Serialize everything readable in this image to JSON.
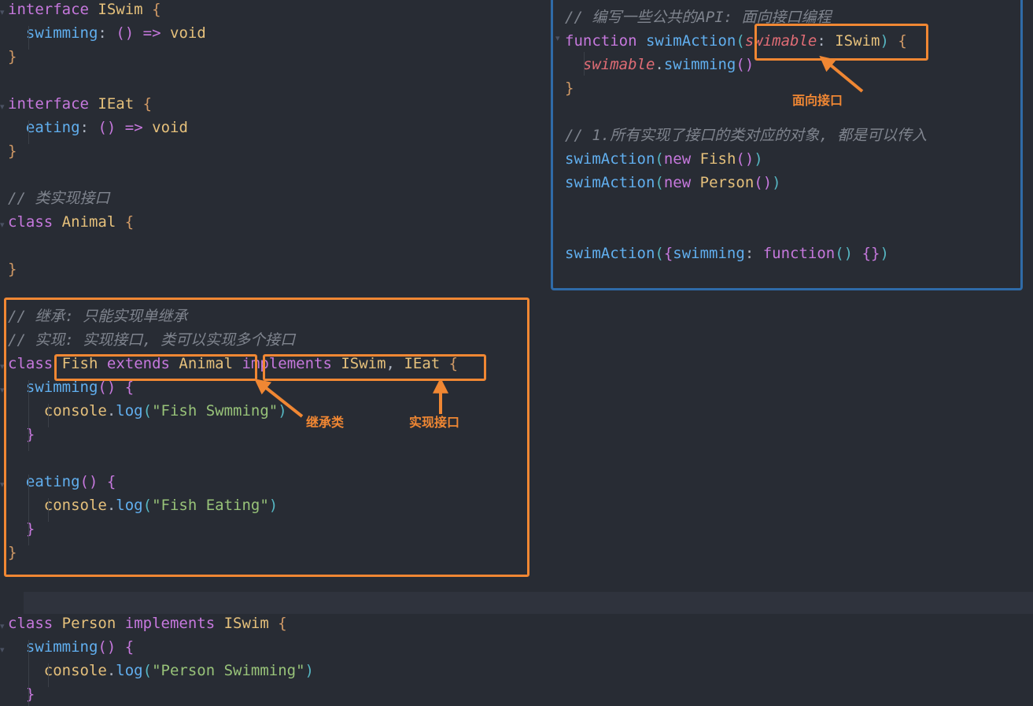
{
  "editor": {
    "background": "#282c34",
    "accent_orange": "#f08733",
    "accent_blue": "#2f6ba8"
  },
  "left_top_code": [
    [
      {
        "t": "interface",
        "c": "kw"
      },
      {
        "t": " "
      },
      {
        "t": "ISwim",
        "c": "type"
      },
      {
        "t": " "
      },
      {
        "t": "{",
        "c": "brace"
      }
    ],
    [
      {
        "t": "  "
      },
      {
        "t": "swimming",
        "c": "prop"
      },
      {
        "t": ":",
        "c": "punc"
      },
      {
        "t": " "
      },
      {
        "t": "()",
        "c": "paren"
      },
      {
        "t": " "
      },
      {
        "t": "=>",
        "c": "arrow"
      },
      {
        "t": " "
      },
      {
        "t": "void",
        "c": "type"
      }
    ],
    [
      {
        "t": "}",
        "c": "brace"
      }
    ],
    [],
    [
      {
        "t": "interface",
        "c": "kw"
      },
      {
        "t": " "
      },
      {
        "t": "IEat",
        "c": "type"
      },
      {
        "t": " "
      },
      {
        "t": "{",
        "c": "brace"
      }
    ],
    [
      {
        "t": "  "
      },
      {
        "t": "eating",
        "c": "prop"
      },
      {
        "t": ":",
        "c": "punc"
      },
      {
        "t": " "
      },
      {
        "t": "()",
        "c": "paren"
      },
      {
        "t": " "
      },
      {
        "t": "=>",
        "c": "arrow"
      },
      {
        "t": " "
      },
      {
        "t": "void",
        "c": "type"
      }
    ],
    [
      {
        "t": "}",
        "c": "brace"
      }
    ],
    [],
    [
      {
        "t": "// 类实现接口",
        "c": "cmt"
      }
    ],
    [
      {
        "t": "class",
        "c": "kw"
      },
      {
        "t": " "
      },
      {
        "t": "Animal",
        "c": "type"
      },
      {
        "t": " "
      },
      {
        "t": "{",
        "c": "brace"
      }
    ],
    [],
    [
      {
        "t": "}",
        "c": "brace"
      }
    ]
  ],
  "left_boxed_code": [
    [
      {
        "t": "// 继承: 只能实现单继承",
        "c": "cmt"
      }
    ],
    [
      {
        "t": "// 实现: 实现接口, 类可以实现多个接口",
        "c": "cmt"
      }
    ],
    [
      {
        "t": "class",
        "c": "kw"
      },
      {
        "t": " "
      },
      {
        "t": "Fish",
        "c": "type"
      },
      {
        "t": " "
      },
      {
        "t": "extends",
        "c": "kw"
      },
      {
        "t": " "
      },
      {
        "t": "Animal",
        "c": "type"
      },
      {
        "t": " "
      },
      {
        "t": "implements",
        "c": "kw"
      },
      {
        "t": " "
      },
      {
        "t": "ISwim",
        "c": "type"
      },
      {
        "t": ",",
        "c": "punc"
      },
      {
        "t": " "
      },
      {
        "t": "IEat",
        "c": "type"
      },
      {
        "t": " "
      },
      {
        "t": "{",
        "c": "brace"
      }
    ],
    [
      {
        "t": "  "
      },
      {
        "t": "swimming",
        "c": "prop"
      },
      {
        "t": "()",
        "c": "paren"
      },
      {
        "t": " "
      },
      {
        "t": "{",
        "c": "brace2"
      }
    ],
    [
      {
        "t": "    "
      },
      {
        "t": "console",
        "c": "obj"
      },
      {
        "t": ".",
        "c": "punc"
      },
      {
        "t": "log",
        "c": "prop"
      },
      {
        "t": "(",
        "c": "teal"
      },
      {
        "t": "\"Fish Swmming\"",
        "c": "str"
      },
      {
        "t": ")",
        "c": "teal"
      }
    ],
    [
      {
        "t": "  "
      },
      {
        "t": "}",
        "c": "brace2"
      }
    ],
    [],
    [
      {
        "t": "  "
      },
      {
        "t": "eating",
        "c": "prop"
      },
      {
        "t": "()",
        "c": "paren"
      },
      {
        "t": " "
      },
      {
        "t": "{",
        "c": "brace2"
      }
    ],
    [
      {
        "t": "    "
      },
      {
        "t": "console",
        "c": "obj"
      },
      {
        "t": ".",
        "c": "punc"
      },
      {
        "t": "log",
        "c": "prop"
      },
      {
        "t": "(",
        "c": "teal"
      },
      {
        "t": "\"Fish Eating\"",
        "c": "str"
      },
      {
        "t": ")",
        "c": "teal"
      }
    ],
    [
      {
        "t": "  "
      },
      {
        "t": "}",
        "c": "brace2"
      }
    ],
    [
      {
        "t": "}",
        "c": "brace"
      }
    ]
  ],
  "left_bottom_code": [
    [],
    [
      {
        "t": "class",
        "c": "kw"
      },
      {
        "t": " "
      },
      {
        "t": "Person",
        "c": "type"
      },
      {
        "t": " "
      },
      {
        "t": "implements",
        "c": "kw"
      },
      {
        "t": " "
      },
      {
        "t": "ISwim",
        "c": "type"
      },
      {
        "t": " "
      },
      {
        "t": "{",
        "c": "brace"
      }
    ],
    [
      {
        "t": "  "
      },
      {
        "t": "swimming",
        "c": "prop"
      },
      {
        "t": "()",
        "c": "paren"
      },
      {
        "t": " "
      },
      {
        "t": "{",
        "c": "brace2"
      }
    ],
    [
      {
        "t": "    "
      },
      {
        "t": "console",
        "c": "obj"
      },
      {
        "t": ".",
        "c": "punc"
      },
      {
        "t": "log",
        "c": "prop"
      },
      {
        "t": "(",
        "c": "teal"
      },
      {
        "t": "\"Person Swimming\"",
        "c": "str"
      },
      {
        "t": ")",
        "c": "teal"
      }
    ],
    [
      {
        "t": "  "
      },
      {
        "t": "}",
        "c": "brace2"
      }
    ]
  ],
  "right_code": [
    [
      {
        "t": "// 编写一些公共的API: 面向接口编程",
        "c": "cmt"
      }
    ],
    [
      {
        "t": "function",
        "c": "kw"
      },
      {
        "t": " "
      },
      {
        "t": "swimAction",
        "c": "prop"
      },
      {
        "t": "(",
        "c": "teal"
      },
      {
        "t": "swimable",
        "c": "param"
      },
      {
        "t": ":",
        "c": "punc"
      },
      {
        "t": " "
      },
      {
        "t": "ISwim",
        "c": "type"
      },
      {
        "t": ")",
        "c": "teal"
      },
      {
        "t": " "
      },
      {
        "t": "{",
        "c": "brace"
      }
    ],
    [
      {
        "t": "  "
      },
      {
        "t": "swimable",
        "c": "param"
      },
      {
        "t": ".",
        "c": "punc"
      },
      {
        "t": "swimming",
        "c": "prop"
      },
      {
        "t": "()",
        "c": "paren"
      }
    ],
    [
      {
        "t": "}",
        "c": "brace"
      }
    ],
    [],
    [
      {
        "t": "// 1.所有实现了接口的类对应的对象, 都是可以传入",
        "c": "cmt"
      }
    ],
    [
      {
        "t": "swimAction",
        "c": "prop"
      },
      {
        "t": "(",
        "c": "teal"
      },
      {
        "t": "new",
        "c": "kw"
      },
      {
        "t": " "
      },
      {
        "t": "Fish",
        "c": "type"
      },
      {
        "t": "()",
        "c": "paren"
      },
      {
        "t": ")",
        "c": "teal"
      }
    ],
    [
      {
        "t": "swimAction",
        "c": "prop"
      },
      {
        "t": "(",
        "c": "teal"
      },
      {
        "t": "new",
        "c": "kw"
      },
      {
        "t": " "
      },
      {
        "t": "Person",
        "c": "type"
      },
      {
        "t": "()",
        "c": "paren"
      },
      {
        "t": ")",
        "c": "teal"
      }
    ],
    [],
    [],
    [
      {
        "t": "swimAction",
        "c": "prop"
      },
      {
        "t": "(",
        "c": "teal"
      },
      {
        "t": "{",
        "c": "brace2"
      },
      {
        "t": "swimming",
        "c": "prop"
      },
      {
        "t": ":",
        "c": "punc"
      },
      {
        "t": " "
      },
      {
        "t": "function",
        "c": "kw"
      },
      {
        "t": "()",
        "c": "teal"
      },
      {
        "t": " "
      },
      {
        "t": "{}",
        "c": "brace2"
      },
      {
        "t": ")",
        "c": "teal"
      }
    ]
  ],
  "annotations": {
    "interface_oriented": "面向接口",
    "inherit_class": "继承类",
    "implement_interface": "实现接口"
  }
}
